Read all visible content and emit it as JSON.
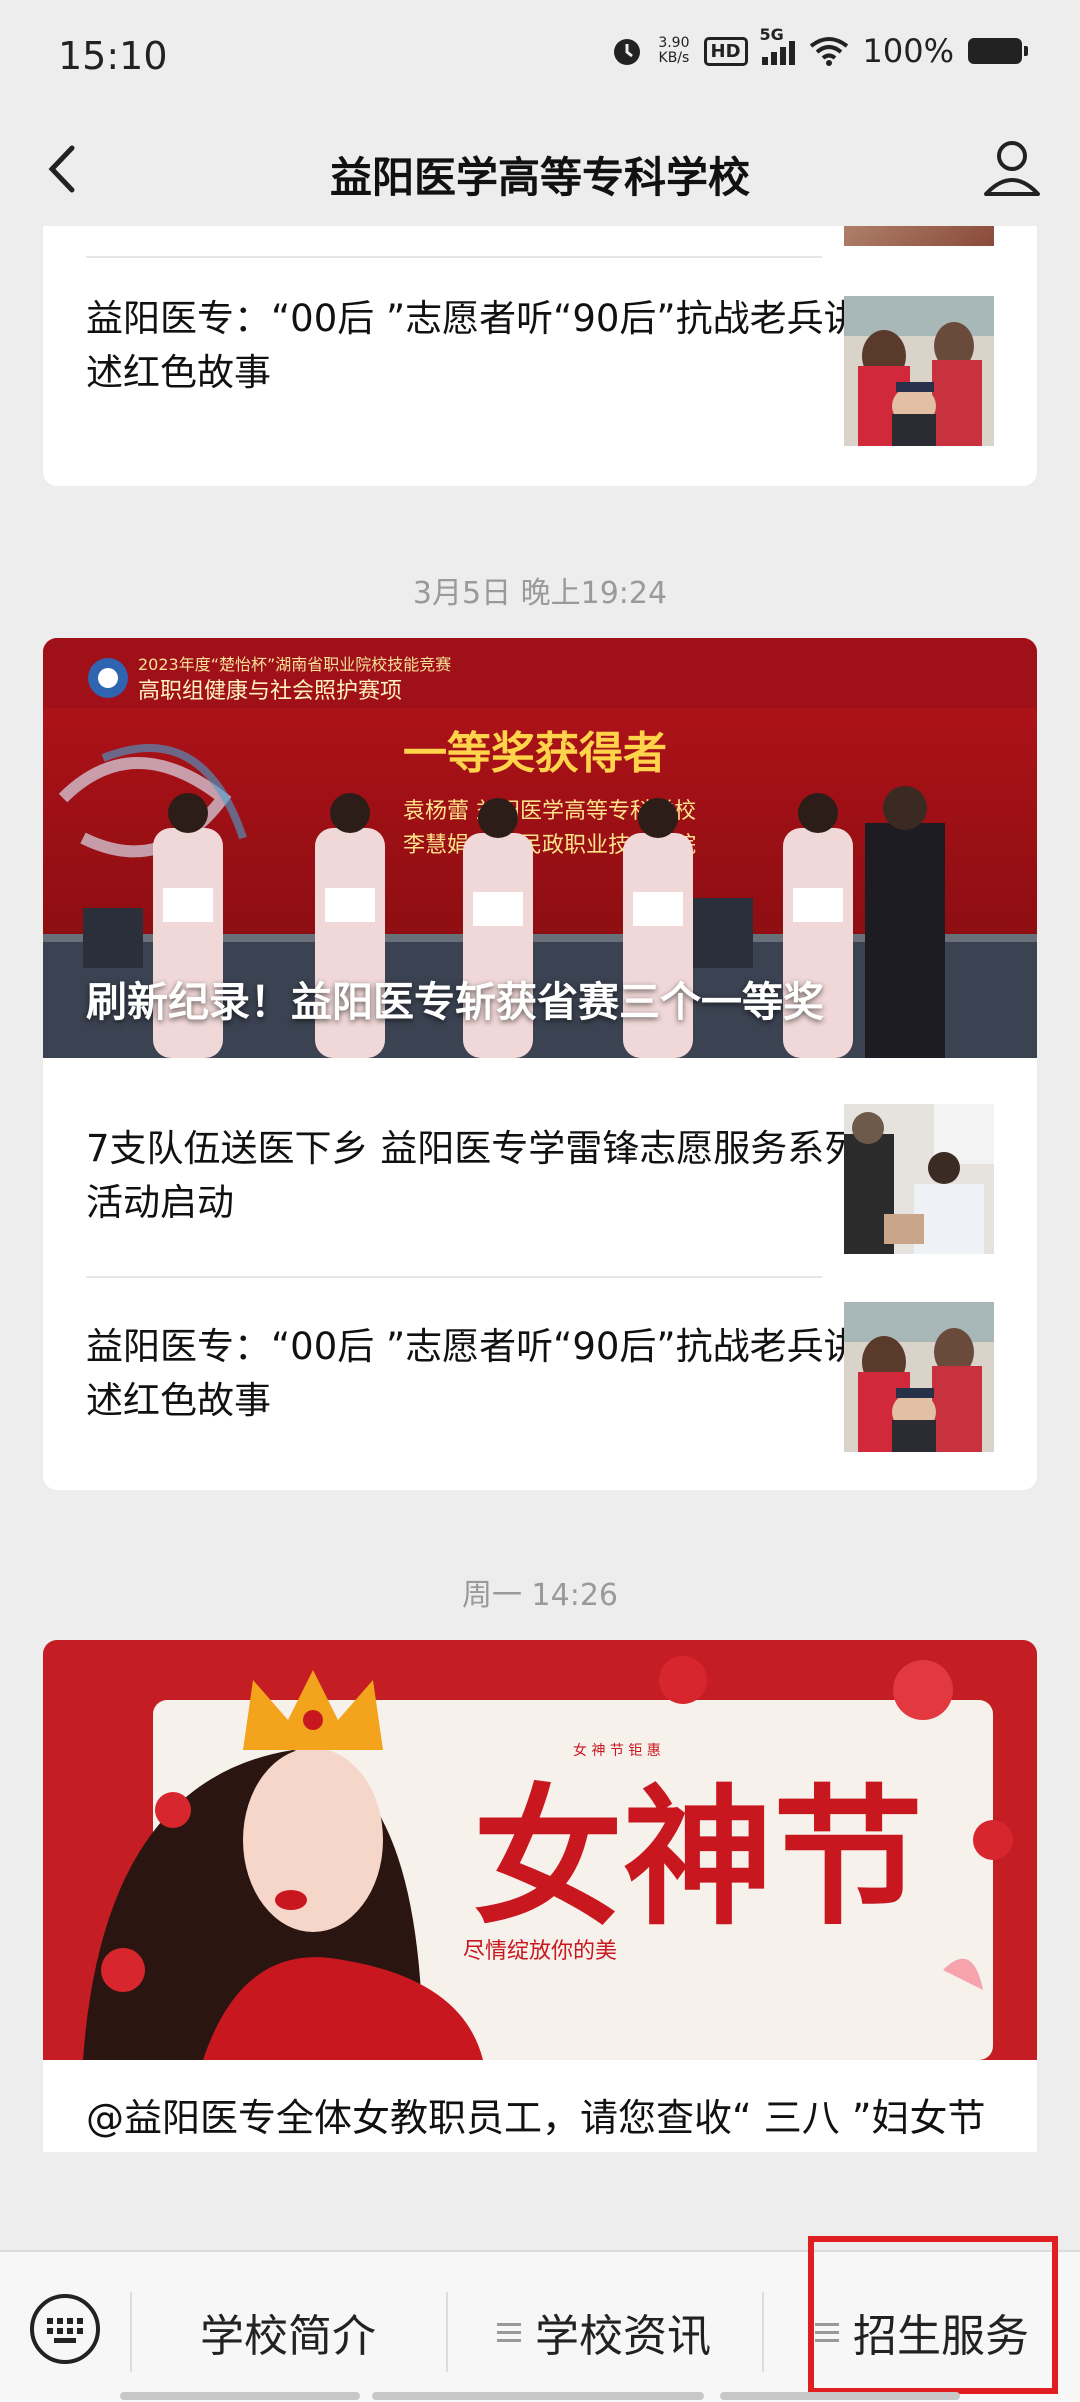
{
  "status_bar": {
    "time": "15:10",
    "speed_value": "3.90",
    "speed_unit": "KB/s",
    "hd_label": "HD",
    "network": "5G",
    "battery": "100%",
    "icons": [
      "alarm-icon",
      "hd-icon",
      "signal-icon",
      "wifi-icon",
      "battery-icon"
    ]
  },
  "nav": {
    "title": "益阳医学高等专科学校",
    "back_icon": "back-chevron-icon",
    "profile_icon": "user-profile-icon"
  },
  "feed": {
    "group1": {
      "articles": [
        {
          "title": "益阳医专：“00后 ”志愿者听“90后”抗战老兵讲述红色故事"
        }
      ]
    },
    "group2": {
      "timestamp": "3月5日 晚上19:24",
      "headline": "刷新纪录！益阳医专斩获省赛三个一等奖",
      "articles": [
        {
          "title": "7支队伍送医下乡 益阳医专学雷锋志愿服务系列活动启动"
        },
        {
          "title": "益阳医专：“00后 ”志愿者听“90后”抗战老兵讲述红色故事"
        }
      ]
    },
    "group3": {
      "timestamp": "周一 14:26",
      "banner_text": "女神节",
      "banner_sub": "尽情绽放你的美",
      "banner_top": "女 神 节 钜 惠",
      "headline": "@益阳医专全体女教职员工，请您查收“ 三八 ”妇女节的慰问信"
    },
    "award_banner": {
      "line1": "2023年度“楚怡杯”湖南省职业院校技能竞赛",
      "line2": "高职组健康与社会照护赛项",
      "title": "一等奖获得者",
      "name1": "袁杨蕾 益阳医学高等专科学校",
      "name2": "李慧娟 长沙民政职业技术学院"
    }
  },
  "menu": {
    "keyboard_icon": "keyboard-icon",
    "items": [
      "学校简介",
      "学校资讯",
      "招生服务"
    ]
  }
}
